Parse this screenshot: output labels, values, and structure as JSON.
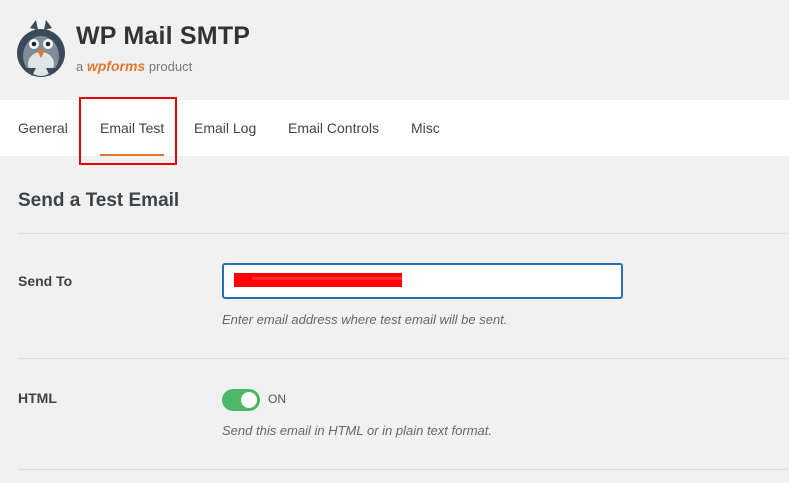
{
  "brand": {
    "title": "WP Mail SMTP",
    "sub_prefix": "a",
    "sub_brand": "wpforms",
    "sub_suffix": "product",
    "accent": "#e27730"
  },
  "tabs": [
    {
      "label": "General",
      "active": false
    },
    {
      "label": "Email Test",
      "active": true
    },
    {
      "label": "Email Log",
      "active": false
    },
    {
      "label": "Email Controls",
      "active": false
    },
    {
      "label": "Misc",
      "active": false
    }
  ],
  "section": {
    "title": "Send a Test Email"
  },
  "fields": {
    "send_to": {
      "label": "Send To",
      "value": "",
      "help": "Enter email address where test email will be sent."
    },
    "html": {
      "label": "HTML",
      "state": "ON",
      "help": "Send this email in HTML or in plain text format.",
      "toggle_color": "#4ab866"
    }
  },
  "icons": {
    "logo": "pigeon-mascot-icon"
  }
}
